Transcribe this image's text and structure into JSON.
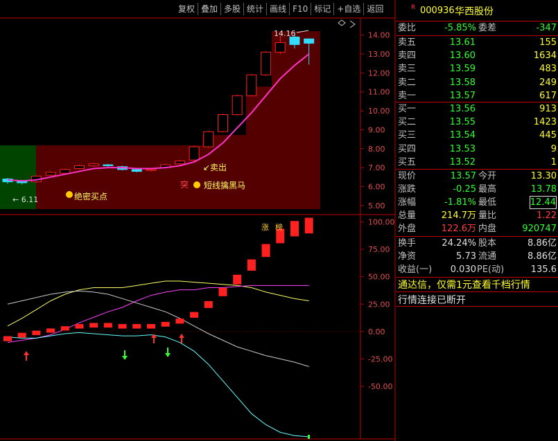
{
  "toolbar": [
    "复权",
    "叠加",
    "多股",
    "统计",
    "画线",
    "F10",
    "标记",
    "+自选",
    "返回"
  ],
  "stock": {
    "flag": "R",
    "code": "000936",
    "name": "华西股份"
  },
  "order_ratio": {
    "label": "委比",
    "value": "-5.85%",
    "label2": "委差",
    "value2": "-347"
  },
  "asks": [
    {
      "label": "卖五",
      "price": "13.61",
      "vol": "155"
    },
    {
      "label": "卖四",
      "price": "13.60",
      "vol": "1634"
    },
    {
      "label": "卖三",
      "price": "13.59",
      "vol": "483"
    },
    {
      "label": "卖二",
      "price": "13.58",
      "vol": "249"
    },
    {
      "label": "卖一",
      "price": "13.57",
      "vol": "617"
    }
  ],
  "bids": [
    {
      "label": "买一",
      "price": "13.56",
      "vol": "913"
    },
    {
      "label": "买二",
      "price": "13.55",
      "vol": "1423"
    },
    {
      "label": "买三",
      "price": "13.54",
      "vol": "445"
    },
    {
      "label": "买四",
      "price": "13.53",
      "vol": "9"
    },
    {
      "label": "买五",
      "price": "13.52",
      "vol": "1"
    }
  ],
  "quote": {
    "now_label": "现价",
    "now": "13.57",
    "open_label": "今开",
    "open": "13.30",
    "chg_label": "涨跌",
    "chg": "-0.25",
    "high_label": "最高",
    "high": "13.78",
    "pct_label": "涨幅",
    "pct": "-1.81%",
    "low_label": "最低",
    "low": "12.44",
    "vol_label": "总量",
    "vol": "214.7万",
    "vr_label": "量比",
    "vr": "1.22",
    "out_label": "外盘",
    "out": "122.6万",
    "in_label": "内盘",
    "in": "920747"
  },
  "fundamentals": {
    "turn_label": "换手",
    "turn": "24.24%",
    "cap_label": "股本",
    "cap": "8.86亿",
    "nav_label": "净资",
    "nav": "5.73",
    "float_label": "流通",
    "float": "8.86亿",
    "eps_label": "收益(一)",
    "eps": "0.030",
    "pe_label": "PE(动)",
    "pe": "135.6"
  },
  "notice": "通达信，仅需1元查看千档行情",
  "status": "行情连接已断开",
  "annotations": {
    "high_mark": "14.16",
    "low_mark": "6.11",
    "sell": "卖出",
    "buy": "绝密买点",
    "dark_horse": "短线擒黑马",
    "tu": "突",
    "zhang": "涨",
    "bang": "榜"
  },
  "colors": {
    "up": "#ff2020",
    "down": "#33ff33",
    "bg": "#000000",
    "border": "#c00000",
    "zone_red": "#550000",
    "zone_green": "#004400",
    "ma": "#ff33cc"
  },
  "chart_data": [
    {
      "type": "candlestick",
      "title": "",
      "y_ticks": [
        5.0,
        6.0,
        7.0,
        8.0,
        9.0,
        10.0,
        11.0,
        12.0,
        13.0,
        14.0
      ],
      "ylim": [
        4.7,
        14.5
      ],
      "candles": [
        {
          "o": 6.4,
          "c": 6.25,
          "h": 6.45,
          "l": 6.15
        },
        {
          "o": 6.3,
          "c": 6.2,
          "h": 6.35,
          "l": 6.11
        },
        {
          "o": 6.25,
          "c": 6.55,
          "h": 6.6,
          "l": 6.2
        },
        {
          "o": 6.6,
          "c": 6.75,
          "h": 6.8,
          "l": 6.55
        },
        {
          "o": 6.7,
          "c": 6.9,
          "h": 6.95,
          "l": 6.65
        },
        {
          "o": 6.95,
          "c": 7.1,
          "h": 7.15,
          "l": 6.9
        },
        {
          "o": 7.1,
          "c": 7.2,
          "h": 7.25,
          "l": 7.05
        },
        {
          "o": 7.15,
          "c": 7.1,
          "h": 7.2,
          "l": 7.05
        },
        {
          "o": 7.05,
          "c": 6.9,
          "h": 7.1,
          "l": 6.85
        },
        {
          "o": 6.9,
          "c": 6.8,
          "h": 6.95,
          "l": 6.75
        },
        {
          "o": 6.85,
          "c": 6.9,
          "h": 6.95,
          "l": 6.8
        },
        {
          "o": 7.0,
          "c": 7.15,
          "h": 7.2,
          "l": 6.95
        },
        {
          "o": 7.2,
          "c": 7.35,
          "h": 7.4,
          "l": 7.15
        },
        {
          "o": 7.4,
          "c": 8.1,
          "h": 8.15,
          "l": 7.35
        },
        {
          "o": 8.1,
          "c": 8.9,
          "h": 8.95,
          "l": 8.05
        },
        {
          "o": 8.9,
          "c": 9.8,
          "h": 9.85,
          "l": 8.85
        },
        {
          "o": 9.8,
          "c": 10.8,
          "h": 10.85,
          "l": 9.75
        },
        {
          "o": 10.8,
          "c": 11.9,
          "h": 11.95,
          "l": 10.75
        },
        {
          "o": 11.9,
          "c": 13.1,
          "h": 13.15,
          "l": 11.85
        },
        {
          "o": 13.1,
          "c": 13.6,
          "h": 14.0,
          "l": 13.0
        },
        {
          "o": 13.9,
          "c": 13.5,
          "h": 14.16,
          "l": 13.3
        },
        {
          "o": 13.8,
          "c": 13.57,
          "h": 13.78,
          "l": 12.44
        }
      ],
      "ma": [
        6.35,
        6.3,
        6.35,
        6.5,
        6.65,
        6.8,
        6.95,
        7.0,
        7.0,
        6.95,
        6.95,
        7.0,
        7.1,
        7.3,
        7.7,
        8.3,
        9.1,
        9.9,
        10.8,
        11.7,
        12.4,
        13.0
      ]
    },
    {
      "type": "line",
      "y_ticks": [
        100.0,
        75.0,
        50.0,
        25.0,
        0.0,
        -25.0,
        -50.0
      ],
      "ylim": [
        -98,
        106
      ],
      "bars": [
        -8,
        -5,
        -3,
        -1,
        1,
        3,
        4,
        4,
        3,
        3,
        3,
        5,
        8,
        14,
        24,
        36,
        48,
        62,
        76,
        90,
        97,
        100
      ],
      "series": [
        {
          "color": "#ffff66",
          "values": [
            5,
            12,
            20,
            28,
            34,
            38,
            40,
            40,
            40,
            42,
            44,
            46,
            46,
            45,
            44,
            43,
            42,
            40,
            36,
            33,
            30,
            28
          ]
        },
        {
          "color": "#ff44ff",
          "values": [
            -10,
            -8,
            -6,
            -3,
            2,
            8,
            13,
            18,
            22,
            28,
            33,
            36,
            38,
            38,
            40,
            40,
            41,
            42,
            42,
            42,
            42,
            42
          ]
        },
        {
          "color": "#cccccc",
          "values": [
            25,
            28,
            31,
            34,
            36,
            37,
            36,
            34,
            30,
            26,
            22,
            18,
            12,
            5,
            -2,
            -8,
            -14,
            -18,
            -22,
            -25,
            -28,
            -32
          ]
        },
        {
          "color": "#66ffff",
          "values": [
            -5,
            -6,
            -6,
            -4,
            -2,
            -1,
            -2,
            -3,
            -4,
            -4,
            -3,
            -5,
            -10,
            -18,
            -30,
            -45,
            -60,
            -75,
            -85,
            -92,
            -95,
            -96
          ]
        }
      ]
    }
  ]
}
